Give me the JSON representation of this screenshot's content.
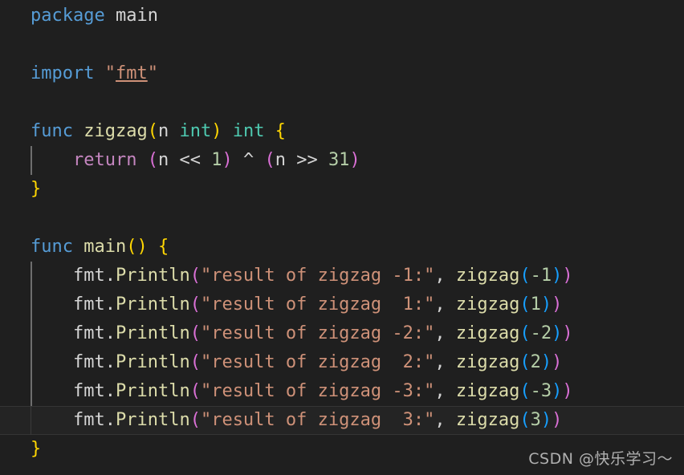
{
  "editor": {
    "language": "go",
    "background_color": "#1f1f1f",
    "current_line_index": 14,
    "colors": {
      "keyword": "#569cd6",
      "function": "#dcdcaa",
      "type": "#4ec9b0",
      "control": "#c586c0",
      "number": "#b5cea8",
      "string": "#ce9178",
      "plain": "#d4d4d4",
      "bracket_level_1": "#ffd602",
      "bracket_level_2": "#da70d6",
      "bracket_level_3": "#179fff",
      "current_line_background": "#242424"
    }
  },
  "code": {
    "l1_package_kw": "package",
    "l1_package_name": " main",
    "l3_import_kw": "import",
    "l3_quote_open": " \"",
    "l3_import_path": "fmt",
    "l3_quote_close": "\"",
    "l5_func_kw": "func",
    "l5_name": " zigzag",
    "l5_paren_open": "(",
    "l5_param": "n ",
    "l5_param_type": "int",
    "l5_paren_close": ")",
    "l5_ret_type": " int",
    "l5_brace_open": " {",
    "l6_indent": "    ",
    "l6_return_kw": "return",
    "l6_paren1_open": " (",
    "l6_expr1_a": "n << ",
    "l6_expr1_num": "1",
    "l6_paren1_close": ")",
    "l6_xor": " ^ ",
    "l6_paren2_open": "(",
    "l6_expr2_a": "n >> ",
    "l6_expr2_num": "31",
    "l6_paren2_close": ")",
    "l7_brace_close": "}",
    "l9_func_kw": "func",
    "l9_name": " main",
    "l9_parens": "()",
    "l9_brace_open": " {",
    "call_indent": "    ",
    "call_receiver": "fmt",
    "call_dot": ".",
    "call_method": "Println",
    "call_paren_open": "(",
    "call_comma": ", ",
    "call_inner_fn": "zigzag",
    "call_inner_paren_open": "(",
    "call_inner_paren_close": ")",
    "call_paren_close": ")",
    "println_lines": [
      {
        "message": "\"result of zigzag -1:\"",
        "arg": "-1"
      },
      {
        "message": "\"result of zigzag  1:\"",
        "arg": "1"
      },
      {
        "message": "\"result of zigzag -2:\"",
        "arg": "-2"
      },
      {
        "message": "\"result of zigzag  2:\"",
        "arg": "2"
      },
      {
        "message": "\"result of zigzag -3:\"",
        "arg": "-3"
      },
      {
        "message": "\"result of zigzag  3:\"",
        "arg": "3"
      }
    ],
    "l16_brace_close": "}"
  },
  "watermark": {
    "text": "CSDN @快乐学习～"
  }
}
